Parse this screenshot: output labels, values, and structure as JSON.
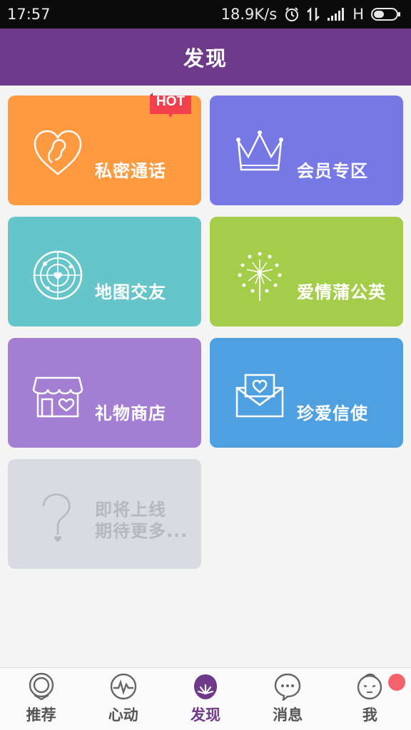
{
  "status_bar": {
    "time": "17:57",
    "net_speed": "18.9K/s",
    "network_type": "H",
    "icons": [
      "alarm-icon",
      "data-arrows-icon",
      "signal-icon",
      "battery-icon"
    ]
  },
  "header": {
    "title": "发现"
  },
  "tiles": [
    {
      "label": "私密通话",
      "icon": "heart-ear-icon",
      "color": "#ff9a41",
      "badge": "HOT"
    },
    {
      "label": "会员专区",
      "icon": "crown-icon",
      "color": "#7678e6"
    },
    {
      "label": "地图交友",
      "icon": "radar-icon",
      "color": "#65c5c9"
    },
    {
      "label": "爱情蒲公英",
      "icon": "dandelion-icon",
      "color": "#a4cd4a"
    },
    {
      "label": "礼物商店",
      "icon": "shop-icon",
      "color": "#a47ed3"
    },
    {
      "label": "珍爱信使",
      "icon": "envelope-heart-icon",
      "color": "#4fa0e0"
    },
    {
      "label": "即将上线\n期待更多...",
      "icon": "question-icon",
      "color": "#d8dce2"
    }
  ],
  "nav": {
    "items": [
      {
        "label": "推荐",
        "icon": "recommend-icon"
      },
      {
        "label": "心动",
        "icon": "heartbeat-icon"
      },
      {
        "label": "发现",
        "icon": "discover-icon",
        "active": true
      },
      {
        "label": "消息",
        "icon": "message-icon"
      },
      {
        "label": "我",
        "icon": "me-face-icon",
        "has_dot": true
      }
    ]
  },
  "colors": {
    "header": "#6e3a8a",
    "active_nav": "#6e3a8a",
    "hot_badge": "#f2404c",
    "notify_dot": "#f4636b"
  }
}
